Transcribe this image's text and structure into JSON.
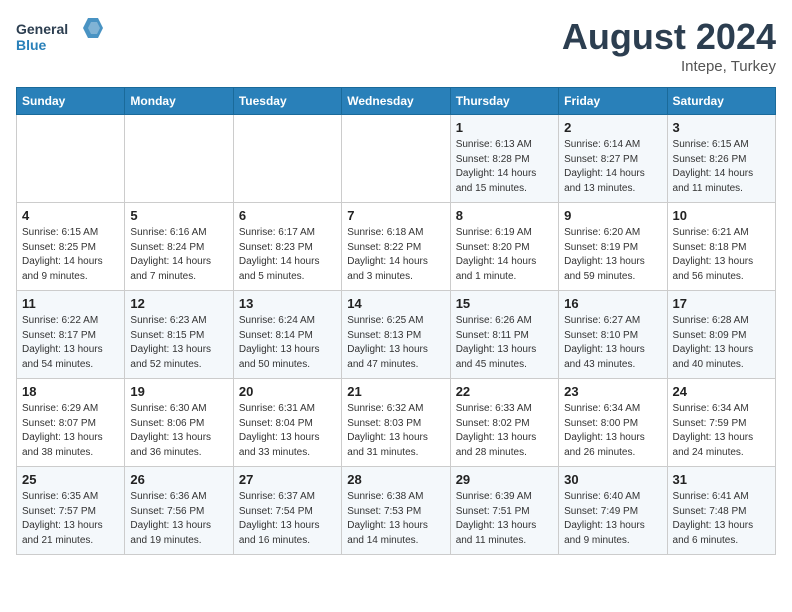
{
  "logo": {
    "line1": "General",
    "line2": "Blue"
  },
  "title": "August 2024",
  "location": "Intepe, Turkey",
  "days_of_week": [
    "Sunday",
    "Monday",
    "Tuesday",
    "Wednesday",
    "Thursday",
    "Friday",
    "Saturday"
  ],
  "weeks": [
    [
      {
        "day": "",
        "info": ""
      },
      {
        "day": "",
        "info": ""
      },
      {
        "day": "",
        "info": ""
      },
      {
        "day": "",
        "info": ""
      },
      {
        "day": "1",
        "info": "Sunrise: 6:13 AM\nSunset: 8:28 PM\nDaylight: 14 hours\nand 15 minutes."
      },
      {
        "day": "2",
        "info": "Sunrise: 6:14 AM\nSunset: 8:27 PM\nDaylight: 14 hours\nand 13 minutes."
      },
      {
        "day": "3",
        "info": "Sunrise: 6:15 AM\nSunset: 8:26 PM\nDaylight: 14 hours\nand 11 minutes."
      }
    ],
    [
      {
        "day": "4",
        "info": "Sunrise: 6:15 AM\nSunset: 8:25 PM\nDaylight: 14 hours\nand 9 minutes."
      },
      {
        "day": "5",
        "info": "Sunrise: 6:16 AM\nSunset: 8:24 PM\nDaylight: 14 hours\nand 7 minutes."
      },
      {
        "day": "6",
        "info": "Sunrise: 6:17 AM\nSunset: 8:23 PM\nDaylight: 14 hours\nand 5 minutes."
      },
      {
        "day": "7",
        "info": "Sunrise: 6:18 AM\nSunset: 8:22 PM\nDaylight: 14 hours\nand 3 minutes."
      },
      {
        "day": "8",
        "info": "Sunrise: 6:19 AM\nSunset: 8:20 PM\nDaylight: 14 hours\nand 1 minute."
      },
      {
        "day": "9",
        "info": "Sunrise: 6:20 AM\nSunset: 8:19 PM\nDaylight: 13 hours\nand 59 minutes."
      },
      {
        "day": "10",
        "info": "Sunrise: 6:21 AM\nSunset: 8:18 PM\nDaylight: 13 hours\nand 56 minutes."
      }
    ],
    [
      {
        "day": "11",
        "info": "Sunrise: 6:22 AM\nSunset: 8:17 PM\nDaylight: 13 hours\nand 54 minutes."
      },
      {
        "day": "12",
        "info": "Sunrise: 6:23 AM\nSunset: 8:15 PM\nDaylight: 13 hours\nand 52 minutes."
      },
      {
        "day": "13",
        "info": "Sunrise: 6:24 AM\nSunset: 8:14 PM\nDaylight: 13 hours\nand 50 minutes."
      },
      {
        "day": "14",
        "info": "Sunrise: 6:25 AM\nSunset: 8:13 PM\nDaylight: 13 hours\nand 47 minutes."
      },
      {
        "day": "15",
        "info": "Sunrise: 6:26 AM\nSunset: 8:11 PM\nDaylight: 13 hours\nand 45 minutes."
      },
      {
        "day": "16",
        "info": "Sunrise: 6:27 AM\nSunset: 8:10 PM\nDaylight: 13 hours\nand 43 minutes."
      },
      {
        "day": "17",
        "info": "Sunrise: 6:28 AM\nSunset: 8:09 PM\nDaylight: 13 hours\nand 40 minutes."
      }
    ],
    [
      {
        "day": "18",
        "info": "Sunrise: 6:29 AM\nSunset: 8:07 PM\nDaylight: 13 hours\nand 38 minutes."
      },
      {
        "day": "19",
        "info": "Sunrise: 6:30 AM\nSunset: 8:06 PM\nDaylight: 13 hours\nand 36 minutes."
      },
      {
        "day": "20",
        "info": "Sunrise: 6:31 AM\nSunset: 8:04 PM\nDaylight: 13 hours\nand 33 minutes."
      },
      {
        "day": "21",
        "info": "Sunrise: 6:32 AM\nSunset: 8:03 PM\nDaylight: 13 hours\nand 31 minutes."
      },
      {
        "day": "22",
        "info": "Sunrise: 6:33 AM\nSunset: 8:02 PM\nDaylight: 13 hours\nand 28 minutes."
      },
      {
        "day": "23",
        "info": "Sunrise: 6:34 AM\nSunset: 8:00 PM\nDaylight: 13 hours\nand 26 minutes."
      },
      {
        "day": "24",
        "info": "Sunrise: 6:34 AM\nSunset: 7:59 PM\nDaylight: 13 hours\nand 24 minutes."
      }
    ],
    [
      {
        "day": "25",
        "info": "Sunrise: 6:35 AM\nSunset: 7:57 PM\nDaylight: 13 hours\nand 21 minutes."
      },
      {
        "day": "26",
        "info": "Sunrise: 6:36 AM\nSunset: 7:56 PM\nDaylight: 13 hours\nand 19 minutes."
      },
      {
        "day": "27",
        "info": "Sunrise: 6:37 AM\nSunset: 7:54 PM\nDaylight: 13 hours\nand 16 minutes."
      },
      {
        "day": "28",
        "info": "Sunrise: 6:38 AM\nSunset: 7:53 PM\nDaylight: 13 hours\nand 14 minutes."
      },
      {
        "day": "29",
        "info": "Sunrise: 6:39 AM\nSunset: 7:51 PM\nDaylight: 13 hours\nand 11 minutes."
      },
      {
        "day": "30",
        "info": "Sunrise: 6:40 AM\nSunset: 7:49 PM\nDaylight: 13 hours\nand 9 minutes."
      },
      {
        "day": "31",
        "info": "Sunrise: 6:41 AM\nSunset: 7:48 PM\nDaylight: 13 hours\nand 6 minutes."
      }
    ]
  ]
}
